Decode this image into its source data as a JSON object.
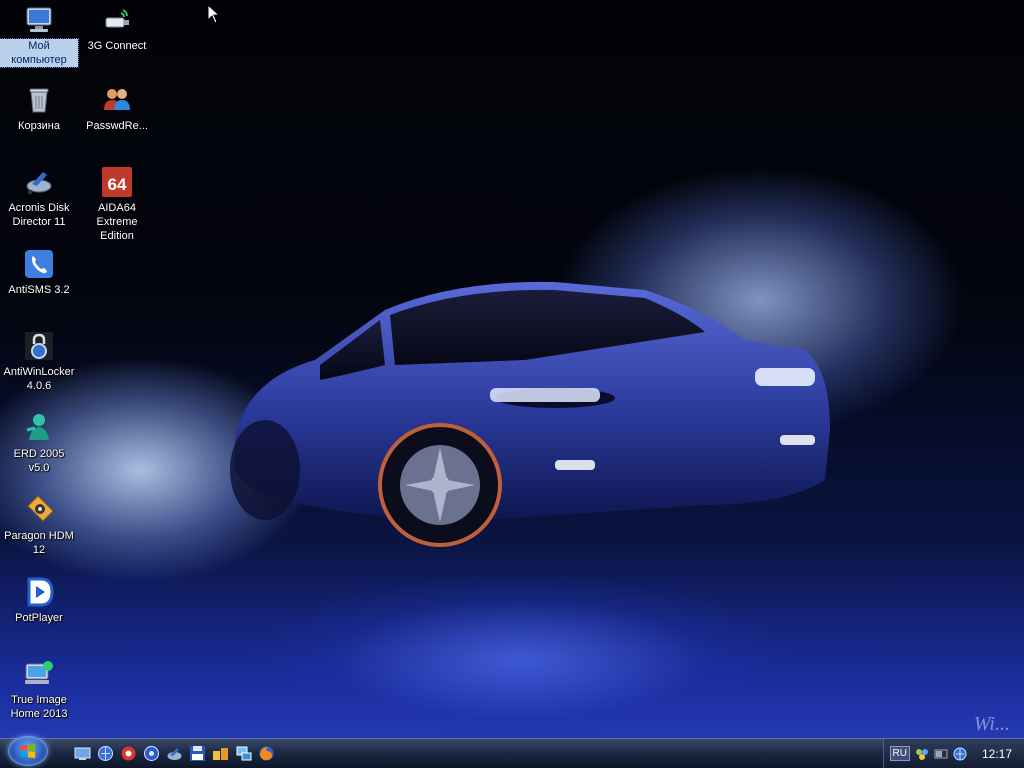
{
  "desktop": {
    "icons": [
      {
        "id": "my-computer",
        "label": "Мой компьютер",
        "icon": "computer-icon",
        "selected": true
      },
      {
        "id": "3g-connect",
        "label": "3G Connect",
        "icon": "usb-modem-icon"
      },
      {
        "id": "recycle-bin",
        "label": "Корзина",
        "icon": "recycle-bin-icon"
      },
      {
        "id": "passwdreset",
        "label": "PasswdRe...",
        "icon": "users-icon"
      },
      {
        "id": "acronis",
        "label": "Acronis Disk Director 11",
        "icon": "disk-tool-icon"
      },
      {
        "id": "aida64",
        "label": "AIDA64 Extreme Edition",
        "icon": "aida64-icon",
        "badge": "64"
      },
      {
        "id": "antisms",
        "label": "AntiSMS 3.2",
        "icon": "phone-icon"
      },
      {
        "id": "antiwinlocker",
        "label": "AntiWinLocker 4.0.6",
        "icon": "lock-icon"
      },
      {
        "id": "erd2005",
        "label": "ERD 2005 v5.0",
        "icon": "erd-figure-icon"
      },
      {
        "id": "paragon",
        "label": "Paragon HDM 12",
        "icon": "paragon-icon"
      },
      {
        "id": "potplayer",
        "label": "PotPlayer",
        "icon": "potplayer-icon"
      },
      {
        "id": "trueimage",
        "label": "True Image Home 2013",
        "icon": "backup-icon"
      }
    ],
    "watermark": "Wi..."
  },
  "taskbar": {
    "start_icon": "windows-logo-icon",
    "quick_launch": [
      "show-desktop-icon",
      "network-globe-icon",
      "record-icon",
      "disc-icon",
      "disk-manager-icon",
      "floppy-save-icon",
      "boxes-icon",
      "network-monitor-icon",
      "firefox-icon"
    ],
    "tray": {
      "language": "RU",
      "icons": [
        "network-tray-icon",
        "battery-tray-icon",
        "globe-tray-icon"
      ],
      "clock": "12:17"
    }
  },
  "colors": {
    "selection": "#b9d1ea",
    "taskbar": "#1d2a44",
    "car_body": "#2a3a9a"
  }
}
